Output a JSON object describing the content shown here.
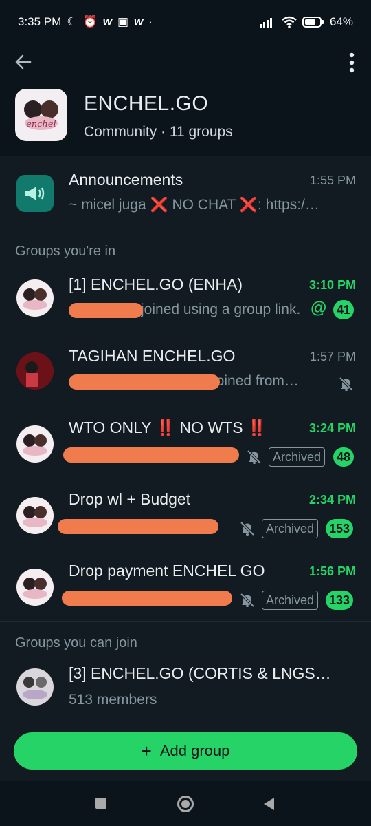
{
  "status": {
    "time": "3:35 PM",
    "battery": "64%"
  },
  "community": {
    "name": "ENCHEL.GO",
    "subtitle": "Community · 11 groups"
  },
  "announcement": {
    "title": "Announcements",
    "time": "1:55 PM",
    "preview": "~ micel juga ❌ NO CHAT ❌: https:/…"
  },
  "sections": {
    "in": "Groups you're in",
    "join": "Groups you can join"
  },
  "groups": [
    {
      "name": "[1] ENCHEL.GO (ENHA)",
      "time": "3:10 PM",
      "preview": "joined using a group link.",
      "badge": "41"
    },
    {
      "name": "TAGIHAN ENCHEL.GO",
      "time": "1:57 PM",
      "preview": "joined from…"
    },
    {
      "name": "WTO ONLY ‼️ NO WTS ‼️",
      "time": "3:24 PM",
      "archived": "Archived",
      "badge": "48"
    },
    {
      "name": "Drop wl + Budget",
      "time": "2:34 PM",
      "archived": "Archived",
      "badge": "153"
    },
    {
      "name": "Drop payment ENCHEL GO",
      "time": "1:56 PM",
      "archived": "Archived",
      "badge": "133"
    }
  ],
  "join_groups": [
    {
      "name": "[3] ENCHEL.GO (CORTIS & LNGS…",
      "members": "513 members"
    }
  ],
  "add_group_label": "Add group",
  "colors": {
    "accent": "#25d366",
    "background": "#0b141a",
    "surface": "#111b21"
  }
}
